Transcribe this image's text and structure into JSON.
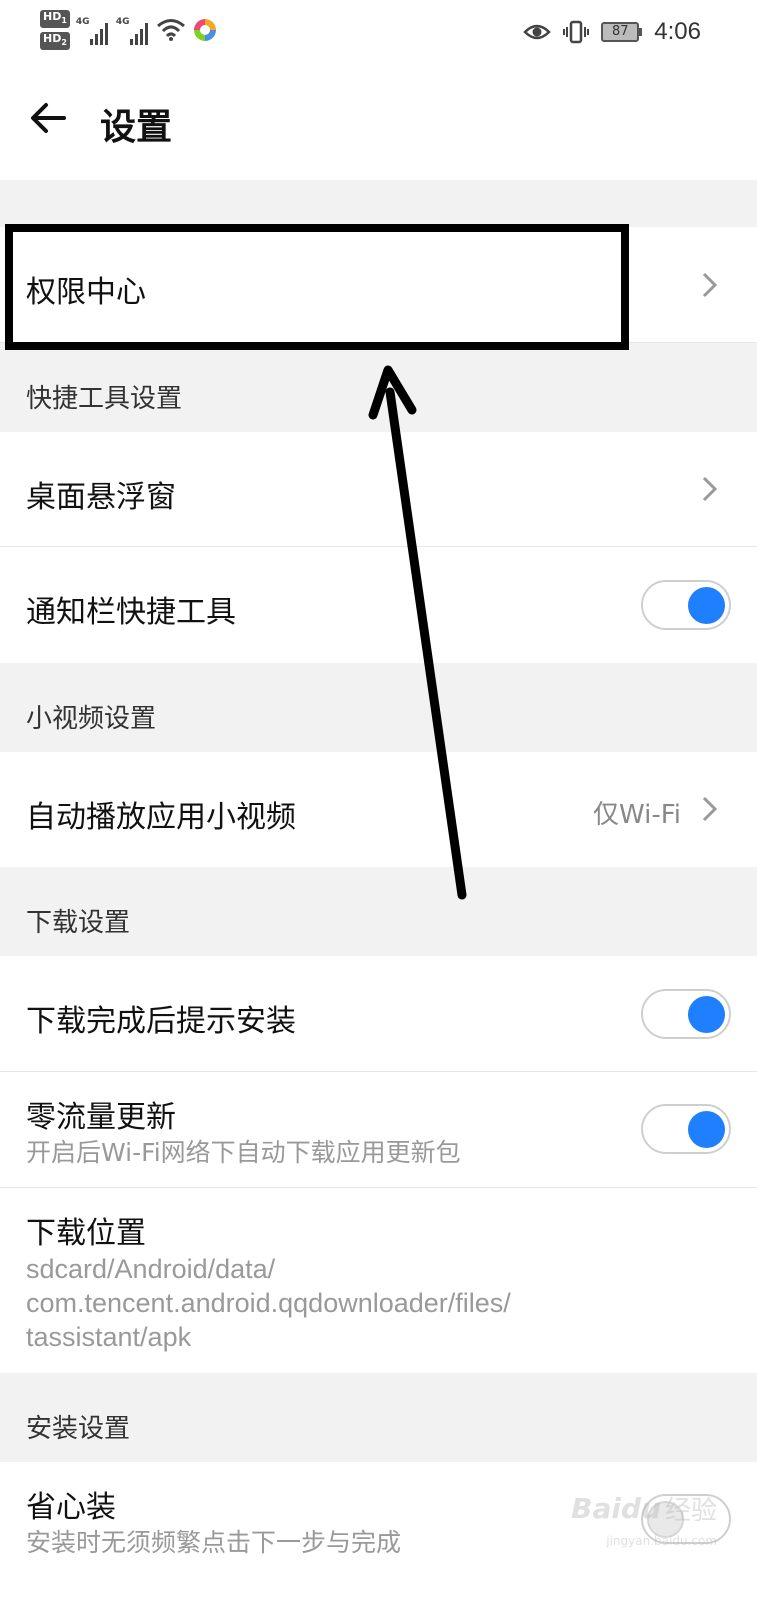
{
  "status_bar": {
    "hd1": "HD",
    "hd1_sub": "1",
    "hd2": "HD",
    "hd2_sub": "2",
    "net1": "4G",
    "net2": "4G",
    "battery": "87",
    "time": "4:06"
  },
  "header": {
    "title": "设置"
  },
  "rows": {
    "permission_center": {
      "label": "权限中心"
    },
    "floating_window": {
      "label": "桌面悬浮窗"
    },
    "notification_tools": {
      "label": "通知栏快捷工具",
      "enabled": true
    },
    "autoplay_video": {
      "label": "自动播放应用小视频",
      "value": "仅Wi-Fi"
    },
    "install_prompt": {
      "label": "下载完成后提示安装",
      "enabled": true
    },
    "zero_traffic": {
      "label": "零流量更新",
      "sub": "开启后Wi-Fi网络下自动下载应用更新包",
      "enabled": true
    },
    "download_location": {
      "label": "下载位置",
      "path_line1": "sdcard/Android/data/",
      "path_line2": "com.tencent.android.qqdownloader/files/",
      "path_line3": "tassistant/apk"
    },
    "easy_install": {
      "label": "省心装",
      "sub": "安装时无须频繁点击下一步与完成",
      "enabled": false
    }
  },
  "sections": {
    "quick_tools": "快捷工具设置",
    "short_video": "小视频设置",
    "download": "下载设置",
    "install": "安装设置"
  },
  "watermark": {
    "brand": "Baidu",
    "brand_cn": "经验",
    "url": "jingyan.baidu.com"
  },
  "colors": {
    "accent": "#1e7fff",
    "section_bg": "#f2f2f2",
    "annotation": "#000000"
  }
}
